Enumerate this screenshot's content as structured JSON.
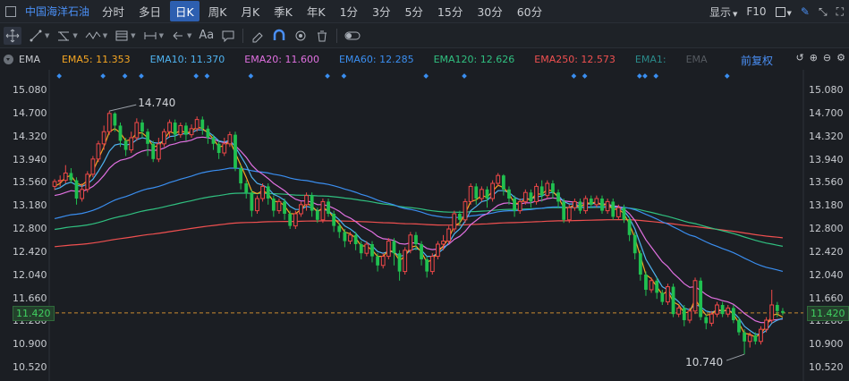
{
  "toolbar": {
    "stock_name": "中国海洋石油",
    "periods": [
      "分时",
      "多日",
      "日K",
      "周K",
      "月K",
      "季K",
      "年K",
      "1分",
      "3分",
      "5分",
      "15分",
      "30分",
      "60分"
    ],
    "active_period": "日K",
    "display_label": "显示",
    "f10_label": "F10"
  },
  "indicator_bar": {
    "name": "EMA",
    "emas": [
      {
        "label": "EMA5: 11.353",
        "color": "#f5a623"
      },
      {
        "label": "EMA10: 11.370",
        "color": "#4fb3f0"
      },
      {
        "label": "EMA20: 11.600",
        "color": "#e070e0"
      },
      {
        "label": "EMA60: 12.285",
        "color": "#3a8ef0"
      },
      {
        "label": "EMA120: 12.626",
        "color": "#30c080"
      },
      {
        "label": "EMA250: 12.573",
        "color": "#f05050"
      },
      {
        "label": "EMA1:",
        "color": "#2a8a8a"
      },
      {
        "label": "EMA",
        "color": "#555a60"
      }
    ],
    "adjust_label": "前复权"
  },
  "y_axis": {
    "ticks": [
      "15.080",
      "14.700",
      "14.320",
      "13.940",
      "13.560",
      "13.180",
      "12.800",
      "12.420",
      "12.040",
      "11.660",
      "11.280",
      "10.900",
      "10.520"
    ],
    "current_price": "11.420"
  },
  "annotations": {
    "high": "14.740",
    "low": "10.740"
  },
  "colors": {
    "up": "#f04848",
    "down": "#20c050",
    "bg": "#1b1e23",
    "accent": "#4a8ff5"
  },
  "chart_data": {
    "type": "candlestick",
    "ylim": [
      10.52,
      15.08
    ],
    "grid": false,
    "current_price": 11.42,
    "candles": [
      [
        13.5,
        13.58,
        13.44,
        13.62
      ],
      [
        13.58,
        13.6,
        13.5,
        13.68
      ],
      [
        13.6,
        13.72,
        13.55,
        13.85
      ],
      [
        13.72,
        13.6,
        13.55,
        13.8
      ],
      [
        13.6,
        13.3,
        13.2,
        13.65
      ],
      [
        13.3,
        13.45,
        13.25,
        13.55
      ],
      [
        13.45,
        13.7,
        13.4,
        13.75
      ],
      [
        13.7,
        13.95,
        13.65,
        14.0
      ],
      [
        13.95,
        14.2,
        13.9,
        14.25
      ],
      [
        14.2,
        14.4,
        14.1,
        14.5
      ],
      [
        14.4,
        14.7,
        14.35,
        14.74
      ],
      [
        14.7,
        14.5,
        14.4,
        14.72
      ],
      [
        14.5,
        14.25,
        14.15,
        14.55
      ],
      [
        14.25,
        14.1,
        14.0,
        14.3
      ],
      [
        14.1,
        14.3,
        14.05,
        14.4
      ],
      [
        14.3,
        14.55,
        14.25,
        14.62
      ],
      [
        14.55,
        14.4,
        14.3,
        14.6
      ],
      [
        14.4,
        14.2,
        14.0,
        14.45
      ],
      [
        14.2,
        13.95,
        13.9,
        14.25
      ],
      [
        13.95,
        14.2,
        13.9,
        14.3
      ],
      [
        14.2,
        14.4,
        14.15,
        14.45
      ],
      [
        14.4,
        14.55,
        14.3,
        14.6
      ],
      [
        14.55,
        14.35,
        14.25,
        14.6
      ],
      [
        14.35,
        14.5,
        14.3,
        14.55
      ],
      [
        14.5,
        14.35,
        14.25,
        14.55
      ],
      [
        14.35,
        14.45,
        14.3,
        14.52
      ],
      [
        14.45,
        14.6,
        14.4,
        14.65
      ],
      [
        14.6,
        14.45,
        14.35,
        14.65
      ],
      [
        14.45,
        14.3,
        14.2,
        14.5
      ],
      [
        14.3,
        14.2,
        14.1,
        14.35
      ],
      [
        14.2,
        14.05,
        13.95,
        14.25
      ],
      [
        14.05,
        14.2,
        14.0,
        14.3
      ],
      [
        14.2,
        14.35,
        14.15,
        14.4
      ],
      [
        14.35,
        13.8,
        13.75,
        14.4
      ],
      [
        13.8,
        13.55,
        13.45,
        13.85
      ],
      [
        13.55,
        13.4,
        13.3,
        13.6
      ],
      [
        13.4,
        13.1,
        13.0,
        13.45
      ],
      [
        13.1,
        13.3,
        13.05,
        13.35
      ],
      [
        13.3,
        13.5,
        13.25,
        13.55
      ],
      [
        13.5,
        13.3,
        13.2,
        13.55
      ],
      [
        13.3,
        13.1,
        13.0,
        13.35
      ],
      [
        13.1,
        13.25,
        13.05,
        13.3
      ],
      [
        13.25,
        13.05,
        12.95,
        13.3
      ],
      [
        13.05,
        12.85,
        12.8,
        13.1
      ],
      [
        12.85,
        13.05,
        12.8,
        13.1
      ],
      [
        13.05,
        13.2,
        13.0,
        13.25
      ],
      [
        13.2,
        13.35,
        13.1,
        13.4
      ],
      [
        13.35,
        13.1,
        13.0,
        13.4
      ],
      [
        13.1,
        12.95,
        12.9,
        13.15
      ],
      [
        12.95,
        13.25,
        12.9,
        13.3
      ],
      [
        13.25,
        13.05,
        13.0,
        13.3
      ],
      [
        13.05,
        12.85,
        12.75,
        13.1
      ],
      [
        12.85,
        12.75,
        12.65,
        12.9
      ],
      [
        12.75,
        12.6,
        12.5,
        12.8
      ],
      [
        12.6,
        12.7,
        12.55,
        12.75
      ],
      [
        12.7,
        12.55,
        12.45,
        12.75
      ],
      [
        12.55,
        12.4,
        12.3,
        12.6
      ],
      [
        12.4,
        12.55,
        12.35,
        12.6
      ],
      [
        12.55,
        12.35,
        12.25,
        12.6
      ],
      [
        12.35,
        12.2,
        12.1,
        12.4
      ],
      [
        12.2,
        12.35,
        12.15,
        12.4
      ],
      [
        12.35,
        12.6,
        12.3,
        12.65
      ],
      [
        12.6,
        12.4,
        12.2,
        12.65
      ],
      [
        12.4,
        12.1,
        11.95,
        12.45
      ],
      [
        12.1,
        12.45,
        12.05,
        12.5
      ],
      [
        12.45,
        12.7,
        12.4,
        12.75
      ],
      [
        12.7,
        12.55,
        12.45,
        12.75
      ],
      [
        12.55,
        12.3,
        12.2,
        12.6
      ],
      [
        12.3,
        12.1,
        12.0,
        12.35
      ],
      [
        12.1,
        12.35,
        12.05,
        12.4
      ],
      [
        12.35,
        12.55,
        12.3,
        12.6
      ],
      [
        12.55,
        12.6,
        12.45,
        12.7
      ],
      [
        12.6,
        12.8,
        12.55,
        12.85
      ],
      [
        12.8,
        13.05,
        12.75,
        13.1
      ],
      [
        13.05,
        12.95,
        12.85,
        13.1
      ],
      [
        12.95,
        13.25,
        12.9,
        13.3
      ],
      [
        13.25,
        13.5,
        13.2,
        13.55
      ],
      [
        13.5,
        13.3,
        13.2,
        13.55
      ],
      [
        13.3,
        13.45,
        13.25,
        13.5
      ],
      [
        13.45,
        13.3,
        13.15,
        13.5
      ],
      [
        13.3,
        13.55,
        13.25,
        13.6
      ],
      [
        13.55,
        13.68,
        13.5,
        13.72
      ],
      [
        13.68,
        13.45,
        13.35,
        13.7
      ],
      [
        13.45,
        13.3,
        13.2,
        13.5
      ],
      [
        13.3,
        13.1,
        13.0,
        13.35
      ],
      [
        13.1,
        13.25,
        13.05,
        13.3
      ],
      [
        13.25,
        13.4,
        13.2,
        13.45
      ],
      [
        13.4,
        13.25,
        13.15,
        13.45
      ],
      [
        13.25,
        13.5,
        13.2,
        13.55
      ],
      [
        13.5,
        13.35,
        13.25,
        13.6
      ],
      [
        13.35,
        13.55,
        13.3,
        13.6
      ],
      [
        13.55,
        13.4,
        13.3,
        13.6
      ],
      [
        13.4,
        13.25,
        13.15,
        13.45
      ],
      [
        13.25,
        12.95,
        12.9,
        13.3
      ],
      [
        12.95,
        13.15,
        12.9,
        13.2
      ],
      [
        13.15,
        13.25,
        13.1,
        13.3
      ],
      [
        13.25,
        13.1,
        13.05,
        13.3
      ],
      [
        13.1,
        13.3,
        13.05,
        13.35
      ],
      [
        13.3,
        13.2,
        13.15,
        13.35
      ],
      [
        13.2,
        13.3,
        13.15,
        13.35
      ],
      [
        13.3,
        13.1,
        13.05,
        13.35
      ],
      [
        13.1,
        13.25,
        13.05,
        13.3
      ],
      [
        13.25,
        13.0,
        12.95,
        13.3
      ],
      [
        13.0,
        13.15,
        12.95,
        13.2
      ],
      [
        13.15,
        12.95,
        12.9,
        13.2
      ],
      [
        12.95,
        12.7,
        12.6,
        13.0
      ],
      [
        12.7,
        12.4,
        12.3,
        12.75
      ],
      [
        12.4,
        12.05,
        11.95,
        12.45
      ],
      [
        12.05,
        11.8,
        11.7,
        12.1
      ],
      [
        11.8,
        11.95,
        11.75,
        12.0
      ],
      [
        11.95,
        11.75,
        11.65,
        12.0
      ],
      [
        11.75,
        11.6,
        11.55,
        11.8
      ],
      [
        11.6,
        11.85,
        11.55,
        11.9
      ],
      [
        11.85,
        11.4,
        11.35,
        11.9
      ],
      [
        11.4,
        11.5,
        11.35,
        11.55
      ],
      [
        11.5,
        11.3,
        11.2,
        11.55
      ],
      [
        11.3,
        11.45,
        11.25,
        11.5
      ],
      [
        11.45,
        11.95,
        11.4,
        12.0
      ],
      [
        11.95,
        11.35,
        11.3,
        12.0
      ],
      [
        11.35,
        11.25,
        11.15,
        11.4
      ],
      [
        11.25,
        11.4,
        11.2,
        11.45
      ],
      [
        11.4,
        11.55,
        11.35,
        11.6
      ],
      [
        11.55,
        11.4,
        11.35,
        11.6
      ],
      [
        11.4,
        11.5,
        11.35,
        11.55
      ],
      [
        11.5,
        11.3,
        11.25,
        11.55
      ],
      [
        11.3,
        11.1,
        11.05,
        11.35
      ],
      [
        11.1,
        10.95,
        10.74,
        11.15
      ],
      [
        10.95,
        11.05,
        10.85,
        11.1
      ],
      [
        11.05,
        10.95,
        10.9,
        11.1
      ],
      [
        10.95,
        11.15,
        10.9,
        11.2
      ],
      [
        11.15,
        11.3,
        11.1,
        11.35
      ],
      [
        11.3,
        11.55,
        11.25,
        11.8
      ],
      [
        11.55,
        11.45,
        11.35,
        11.6
      ],
      [
        11.45,
        11.42,
        11.38,
        11.5
      ]
    ],
    "ema_series": {
      "EMA5": [
        13.5,
        13.55,
        13.65,
        13.68,
        13.55,
        13.52,
        13.6,
        13.75,
        13.95,
        14.15,
        14.4,
        14.45,
        14.38,
        14.25,
        14.27,
        14.38,
        14.38,
        14.3,
        14.15,
        14.17,
        14.27,
        14.4,
        14.37,
        14.42,
        14.38,
        14.4,
        14.48,
        14.45,
        14.38,
        14.28,
        14.15,
        14.17,
        14.25,
        14.05,
        13.85,
        13.65,
        13.42,
        13.38,
        13.43,
        13.38,
        13.25,
        13.25,
        13.18,
        13.05,
        13.05,
        13.12,
        13.22,
        13.18,
        13.08,
        13.15,
        13.1,
        12.98,
        12.88,
        12.75,
        12.72,
        12.65,
        12.52,
        12.52,
        12.45,
        12.35,
        12.35,
        12.45,
        12.42,
        12.28,
        12.35,
        12.5,
        12.52,
        12.42,
        12.25,
        12.3,
        12.42,
        12.52,
        12.65,
        12.85,
        12.9,
        13.05,
        13.25,
        13.28,
        13.35,
        13.32,
        13.42,
        13.52,
        13.48,
        13.38,
        13.22,
        13.22,
        13.3,
        13.28,
        13.38,
        13.37,
        13.45,
        13.42,
        13.32,
        13.15,
        13.15,
        13.2,
        13.15,
        13.23,
        13.22,
        13.25,
        13.18,
        13.22,
        13.12,
        13.13,
        13.05,
        12.88,
        12.65,
        12.35,
        12.05,
        11.98,
        11.85,
        11.72,
        11.78,
        11.6,
        11.55,
        11.42,
        11.43,
        11.65,
        11.5,
        11.38,
        11.4,
        11.48,
        11.45,
        11.47,
        11.4,
        11.25,
        11.08,
        11.07,
        11.02,
        11.08,
        11.2,
        11.38,
        11.4,
        11.35
      ],
      "EMA10": [
        13.45,
        13.48,
        13.54,
        13.57,
        13.52,
        13.5,
        13.54,
        13.62,
        13.75,
        13.9,
        14.08,
        14.18,
        14.2,
        14.18,
        14.2,
        14.27,
        14.3,
        14.28,
        14.22,
        14.21,
        14.25,
        14.32,
        14.33,
        14.37,
        14.36,
        14.38,
        14.43,
        14.43,
        14.4,
        14.33,
        14.25,
        14.23,
        14.26,
        14.15,
        14.0,
        13.85,
        13.65,
        13.55,
        13.52,
        13.47,
        13.37,
        13.33,
        13.27,
        13.17,
        13.12,
        13.12,
        13.17,
        13.15,
        13.1,
        13.12,
        13.1,
        13.03,
        12.95,
        12.85,
        12.8,
        12.73,
        12.63,
        12.58,
        12.52,
        12.43,
        12.4,
        12.43,
        12.42,
        12.35,
        12.37,
        12.45,
        12.48,
        12.45,
        12.35,
        12.35,
        12.4,
        12.47,
        12.57,
        12.72,
        12.8,
        12.93,
        13.1,
        13.17,
        13.25,
        13.27,
        13.35,
        13.43,
        13.43,
        13.4,
        13.32,
        13.28,
        13.3,
        13.29,
        13.33,
        13.34,
        13.39,
        13.4,
        13.35,
        13.25,
        13.21,
        13.21,
        13.18,
        13.21,
        13.21,
        13.23,
        13.2,
        13.21,
        13.16,
        13.15,
        13.1,
        12.98,
        12.8,
        12.55,
        12.3,
        12.15,
        12.0,
        11.85,
        11.8,
        11.68,
        11.6,
        11.5,
        11.47,
        11.56,
        11.52,
        11.45,
        11.43,
        11.46,
        11.45,
        11.46,
        11.43,
        11.33,
        11.2,
        11.13,
        11.07,
        11.07,
        11.13,
        11.25,
        11.3,
        11.33
      ],
      "EMA20": [
        13.35,
        13.37,
        13.4,
        13.43,
        13.42,
        13.42,
        13.45,
        13.5,
        13.58,
        13.68,
        13.8,
        13.88,
        13.93,
        13.95,
        13.98,
        14.04,
        14.08,
        14.1,
        14.09,
        14.1,
        14.13,
        14.18,
        14.2,
        14.23,
        14.24,
        14.26,
        14.3,
        14.31,
        14.3,
        14.28,
        14.24,
        14.22,
        14.23,
        14.17,
        14.08,
        13.98,
        13.85,
        13.76,
        13.7,
        13.63,
        13.55,
        13.49,
        13.43,
        13.35,
        13.29,
        13.26,
        13.26,
        13.24,
        13.2,
        13.2,
        13.18,
        13.14,
        13.09,
        13.02,
        12.98,
        12.92,
        12.85,
        12.8,
        12.75,
        12.68,
        12.64,
        12.63,
        12.61,
        12.56,
        12.55,
        12.57,
        12.57,
        12.54,
        12.48,
        12.46,
        12.47,
        12.5,
        12.55,
        12.63,
        12.68,
        12.76,
        12.87,
        12.94,
        13.01,
        13.05,
        13.12,
        13.19,
        13.22,
        13.23,
        13.21,
        13.21,
        13.23,
        13.23,
        13.26,
        13.27,
        13.3,
        13.31,
        13.3,
        13.26,
        13.25,
        13.24,
        13.22,
        13.23,
        13.22,
        13.23,
        13.21,
        13.21,
        13.18,
        13.17,
        13.13,
        13.05,
        12.94,
        12.78,
        12.62,
        12.5,
        12.38,
        12.26,
        12.18,
        12.07,
        11.99,
        11.9,
        11.84,
        11.85,
        11.79,
        11.72,
        11.67,
        11.65,
        11.62,
        11.6,
        11.56,
        11.49,
        11.41,
        11.35,
        11.29,
        11.26,
        11.26,
        11.3,
        11.31,
        11.32
      ]
    },
    "annotations": {
      "high": 14.74,
      "low": 10.74
    }
  }
}
